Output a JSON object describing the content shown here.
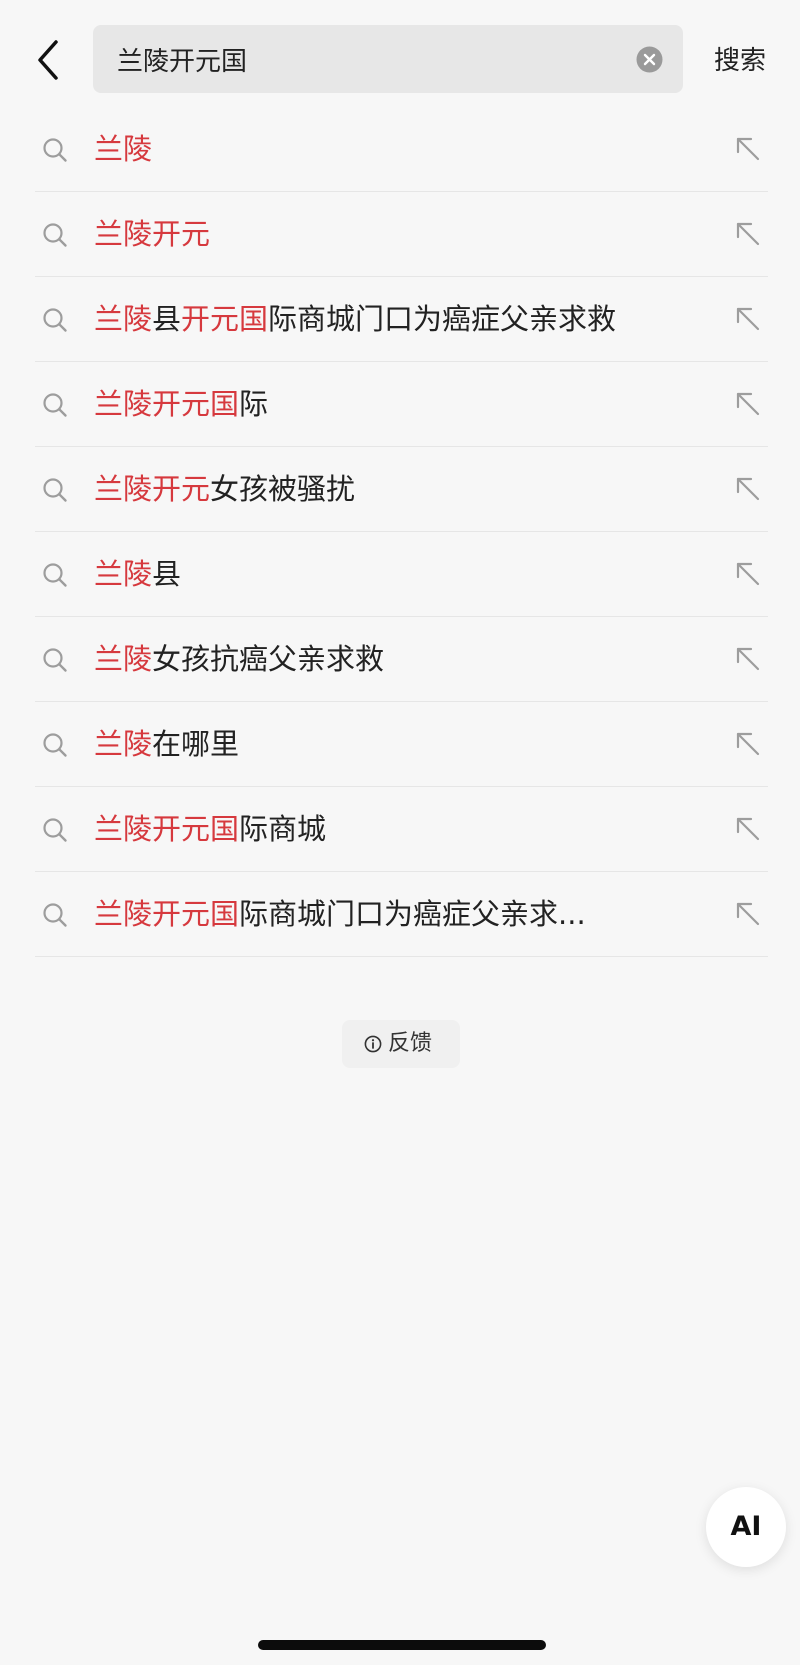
{
  "header": {
    "query": "兰陵开元国",
    "search_label": "搜索"
  },
  "suggestions": [
    {
      "highlight": "兰陵",
      "rest": ""
    },
    {
      "highlight": "兰陵开元",
      "rest": ""
    },
    {
      "segments": [
        {
          "text": "兰陵",
          "hl": true
        },
        {
          "text": "县",
          "hl": false
        },
        {
          "text": "开元国",
          "hl": true
        },
        {
          "text": "际商城门口为癌症父亲求救",
          "hl": false
        }
      ]
    },
    {
      "highlight": "兰陵开元国",
      "rest": "际"
    },
    {
      "highlight": "兰陵开元",
      "rest": "女孩被骚扰"
    },
    {
      "highlight": "兰陵",
      "rest": "县"
    },
    {
      "highlight": "兰陵",
      "rest": "女孩抗癌父亲求救"
    },
    {
      "highlight": "兰陵",
      "rest": "在哪里"
    },
    {
      "highlight": "兰陵开元国",
      "rest": "际商城"
    },
    {
      "highlight": "兰陵开元国",
      "rest": "际商城门口为癌症父亲求..."
    }
  ],
  "feedback_label": "反馈",
  "ai_label": "AI",
  "colors": {
    "highlight": "#d6393e",
    "background": "#f7f7f7",
    "search_box": "#e7e7e7"
  },
  "icons": {
    "back": "chevron-left-icon",
    "clear": "clear-circle-icon",
    "suggestion": "search-icon",
    "fill": "arrow-up-left-icon",
    "feedback": "info-icon"
  }
}
